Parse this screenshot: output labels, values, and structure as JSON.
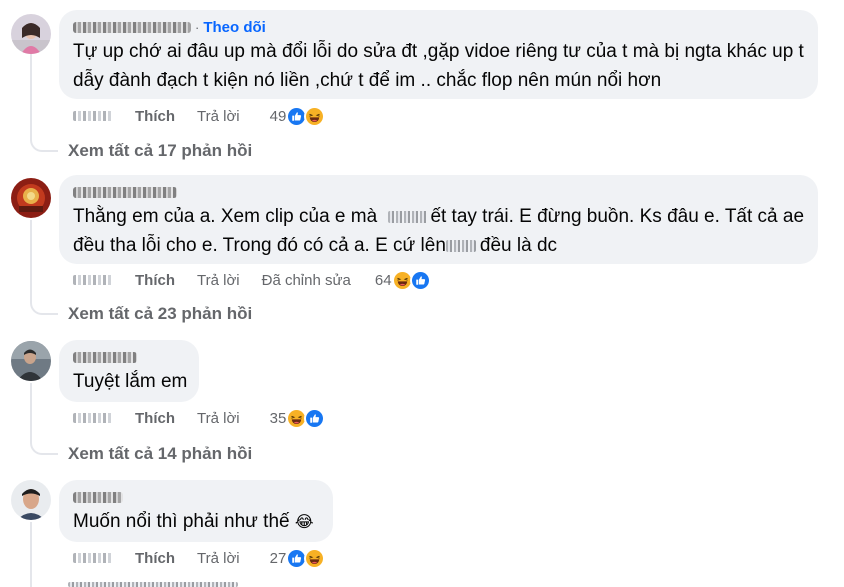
{
  "follow_label": "Theo dõi",
  "actions": {
    "like": "Thích",
    "reply": "Trả lời",
    "edited": "Đã chỉnh sửa"
  },
  "comments": [
    {
      "lines": [
        "Tự up chớ ai đâu up mà đổi lỗi do sửa đt ,gặp vidoe riêng tư của t mà bị ngta khác up t",
        "dẫy đành đạch t kiện nó liền ,chứ t để im .. chắc flop nên mún nổi hơn"
      ],
      "reaction_count": "49",
      "reactions": [
        "like",
        "haha"
      ],
      "view_more": "Xem tất cả 17 phản hồi"
    },
    {
      "line1_a": "Thằng em của a. Xem clip của e mà",
      "line1_b": "ết tay trái. E đừng buồn. Ks đâu e. Tất cả ae",
      "line2_a": "đều tha lỗi cho e. Trong đó có cả a. E cứ lên",
      "line2_b": "đều là dc",
      "reaction_count": "64",
      "reactions": [
        "haha",
        "like"
      ],
      "view_more": "Xem tất cả 23 phản hồi"
    },
    {
      "lines": [
        "Tuyệt lắm em"
      ],
      "reaction_count": "35",
      "reactions": [
        "haha",
        "like"
      ],
      "view_more": "Xem tất cả 14 phản hồi"
    },
    {
      "lines": [
        "Muốn nổi thì phải như thế"
      ],
      "inline_emoji": "😂",
      "reaction_count": "27",
      "reactions": [
        "like",
        "haha"
      ]
    }
  ],
  "colors": {
    "bubble": "#f0f2f5",
    "link_blue": "#0866ff",
    "meta_gray": "#65676b",
    "like_blue": "#1877f2",
    "haha_yellow": "#f7b125"
  }
}
